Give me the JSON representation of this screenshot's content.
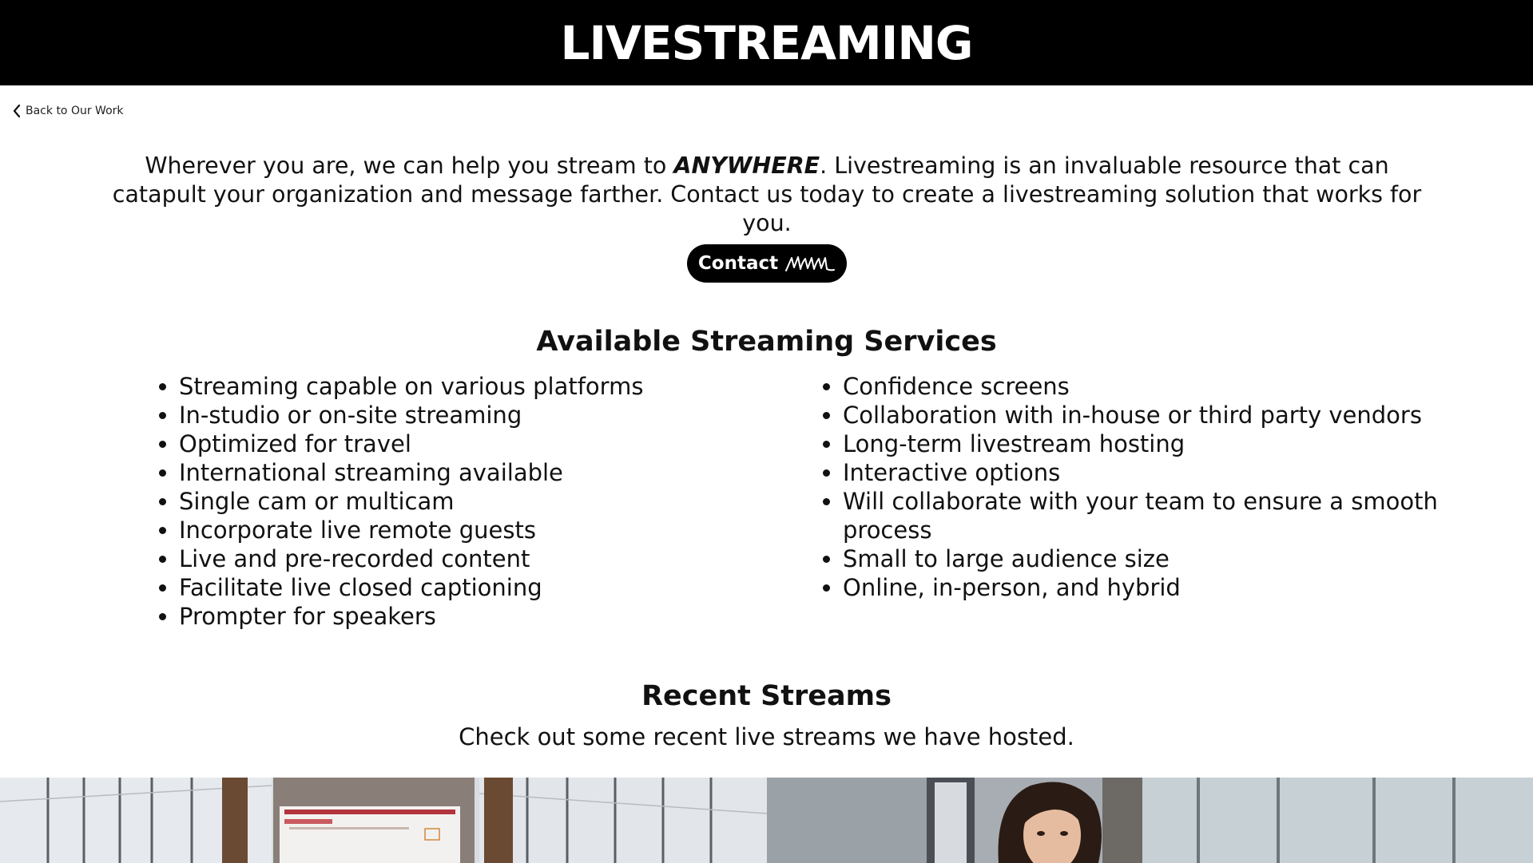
{
  "header": {
    "title": "LIVESTREAMING"
  },
  "back_link": {
    "label": "Back to Our Work",
    "icon": "chevron-left-icon"
  },
  "intro": {
    "before": "Wherever you are, we can help you stream to ",
    "emphasis": "ANYWHERE",
    "after": ". Livestreaming is an invaluable resource that can catapult your organization and message farther. Contact us today to create a livestreaming solution that works for you."
  },
  "contact_button": {
    "label": "Contact",
    "logo": "signature-logo"
  },
  "services": {
    "title": "Available Streaming Services",
    "left": [
      "Streaming capable on various platforms",
      "In-studio or on-site streaming",
      "Optimized for travel",
      "International streaming available",
      "Single cam or multicam",
      "Incorporate live remote guests",
      "Live and pre-recorded content",
      "Facilitate live closed captioning",
      "Prompter for speakers"
    ],
    "right": [
      "Confidence screens",
      "Collaboration with in-house or third party vendors",
      "Long-term livestream hosting",
      "Interactive options",
      "Will collaborate with your team to ensure a smooth process",
      "Small to large audience size",
      "Online, in-person, and hybrid"
    ]
  },
  "recent_streams": {
    "title": "Recent Streams",
    "subtitle": "Check out some recent live streams we have hosted."
  },
  "colors": {
    "header_bg": "#000000",
    "header_text": "#ffffff",
    "text": "#111111",
    "button_bg": "#000000"
  }
}
